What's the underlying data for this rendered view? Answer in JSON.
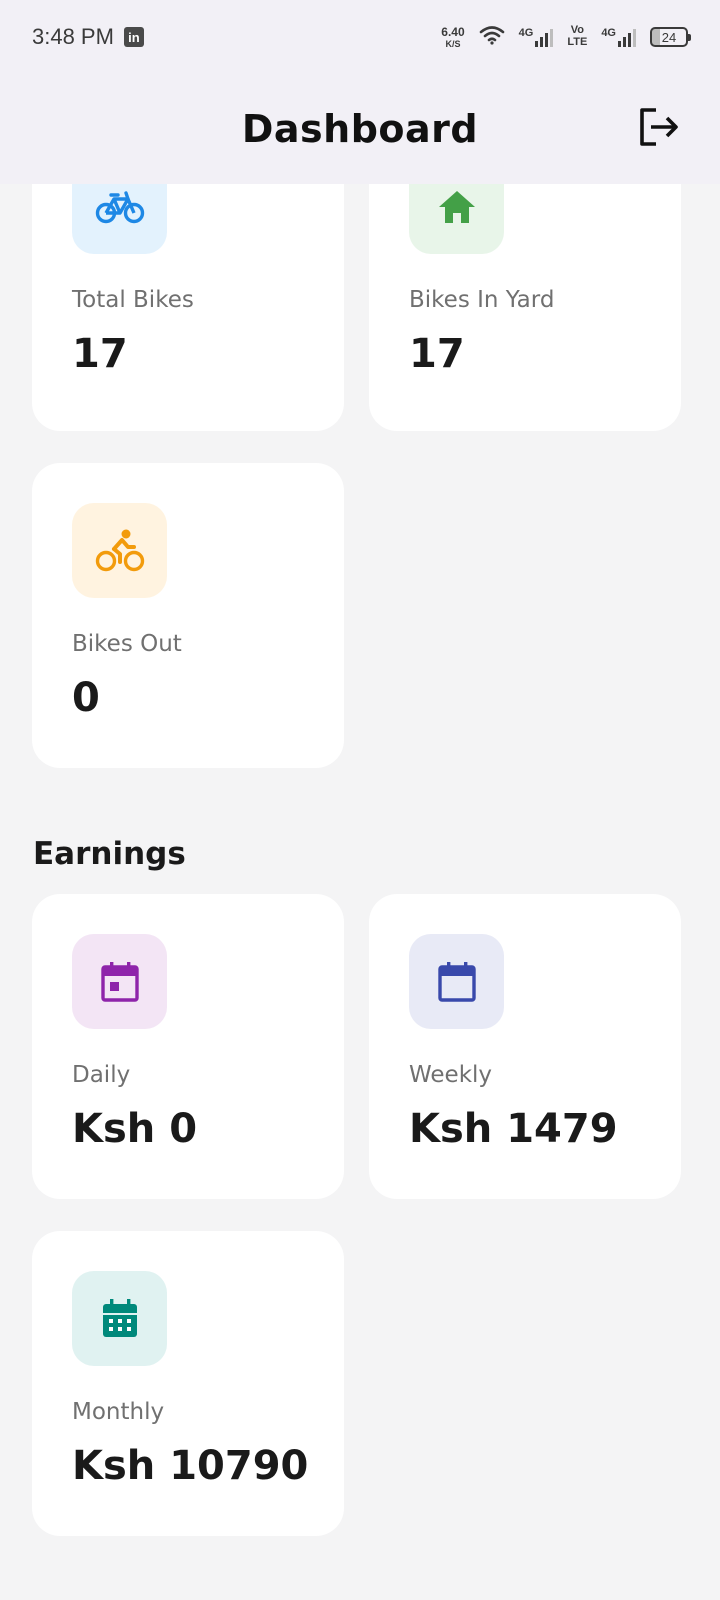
{
  "status_bar": {
    "time": "3:48 PM",
    "linkedin_icon": "linkedin-icon",
    "net_speed_value": "6.40",
    "net_speed_unit": "K/S",
    "wifi_icon": "wifi-icon",
    "network1_label": "4G",
    "volte_top": "Vo",
    "volte_bottom": "LTE",
    "network2_label": "4G",
    "battery_level": "24"
  },
  "header": {
    "title": "Dashboard",
    "logout_icon": "logout-icon"
  },
  "bikes": {
    "total": {
      "label": "Total Bikes",
      "value": "17",
      "icon": "bicycle-icon",
      "color": "#1e88e5",
      "bg": "#e3f2fd"
    },
    "in_yard": {
      "label": "Bikes In Yard",
      "value": "17",
      "icon": "home-icon",
      "color": "#43a047",
      "bg": "#e8f5e9"
    },
    "out": {
      "label": "Bikes Out",
      "value": "0",
      "icon": "cyclist-icon",
      "color": "#f29b0c",
      "bg": "#fff3e0"
    }
  },
  "earnings": {
    "title": "Earnings",
    "daily": {
      "label": "Daily",
      "value": "Ksh 0",
      "icon": "calendar-day-icon",
      "color": "#8e24aa",
      "bg": "#f3e5f5"
    },
    "weekly": {
      "label": "Weekly",
      "value": "Ksh 1479",
      "icon": "calendar-icon",
      "color": "#3949ab",
      "bg": "#e8eaf6"
    },
    "monthly": {
      "label": "Monthly",
      "value": "Ksh 10790",
      "icon": "calendar-month-icon",
      "color": "#00897b",
      "bg": "#e0f2f1"
    }
  }
}
